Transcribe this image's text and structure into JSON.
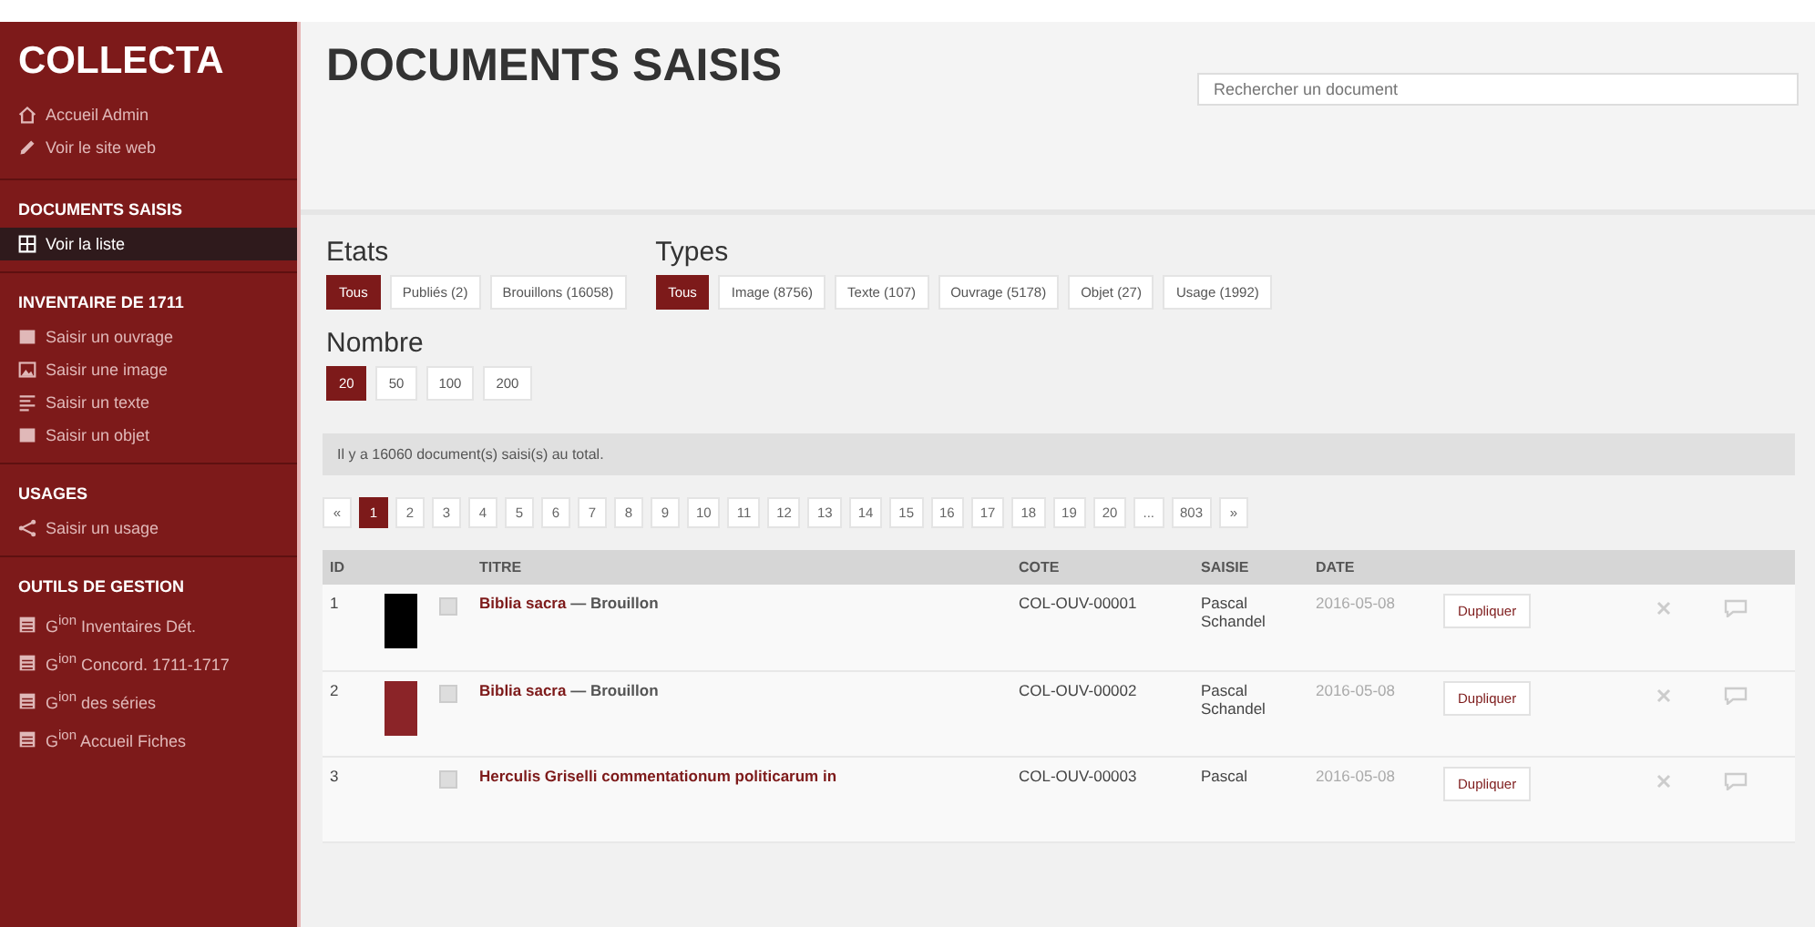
{
  "sidebar": {
    "brand": "COLLECTA",
    "links": [
      {
        "kind": "home",
        "label": "Accueil Admin"
      },
      {
        "kind": "pencil",
        "label": "Voir le site web"
      }
    ],
    "sections": [
      {
        "title": "DOCUMENTS SAISIS",
        "items": [
          {
            "kind": "grid",
            "label": "Voir la liste",
            "selected": true
          }
        ]
      },
      {
        "title": "INVENTAIRE DE 1711",
        "items": [
          {
            "kind": "book",
            "label": "Saisir un ouvrage",
            "selected": false
          },
          {
            "kind": "image",
            "label": "Saisir une image",
            "selected": false
          },
          {
            "kind": "text",
            "label": "Saisir un texte",
            "selected": false
          },
          {
            "kind": "book",
            "label": "Saisir un objet",
            "selected": false
          }
        ]
      },
      {
        "title": "USAGES",
        "items": [
          {
            "kind": "share",
            "label": "Saisir un usage",
            "selected": false
          }
        ]
      },
      {
        "title": "OUTILS DE GESTION",
        "items": [
          {
            "kind": "table",
            "label": "G$^{ion}$ Inventaires Dét.",
            "selected": false
          },
          {
            "kind": "table",
            "label": "G$^{ion}$ Concord. 1711-1717",
            "selected": false
          },
          {
            "kind": "table",
            "label": "G$^{ion}$ des séries",
            "selected": false
          },
          {
            "kind": "table",
            "label": "G$^{ion}$ Accueil Fiches",
            "selected": false
          }
        ]
      }
    ]
  },
  "header": {
    "title": "DOCUMENTS SAISIS",
    "search": {
      "placeholder": "Rechercher un document"
    }
  },
  "filters": [
    {
      "title": "Etats",
      "options": [
        {
          "label": "Tous",
          "selected": true
        },
        {
          "label": "Publiés (2)",
          "selected": false
        },
        {
          "label": "Brouillons (16058)",
          "selected": false
        }
      ]
    },
    {
      "title": "Types",
      "options": [
        {
          "label": "Tous",
          "selected": true
        },
        {
          "label": "Image (8756)",
          "selected": false
        },
        {
          "label": "Texte (107)",
          "selected": false
        },
        {
          "label": "Ouvrage (5178)",
          "selected": false
        },
        {
          "label": "Objet (27)",
          "selected": false
        },
        {
          "label": "Usage (1992)",
          "selected": false
        }
      ]
    },
    {
      "title": "Nombre",
      "options": [
        {
          "label": "20",
          "selected": true
        },
        {
          "label": "50",
          "selected": false
        },
        {
          "label": "100",
          "selected": false
        },
        {
          "label": "200",
          "selected": false
        }
      ]
    }
  ],
  "info": "Il y a 16060 document(s) saisi(s) au total.",
  "pagination": [
    {
      "label": "«",
      "selected": false
    },
    {
      "label": "1",
      "selected": true
    },
    {
      "label": "2",
      "selected": false
    },
    {
      "label": "3",
      "selected": false
    },
    {
      "label": "4",
      "selected": false
    },
    {
      "label": "5",
      "selected": false
    },
    {
      "label": "6",
      "selected": false
    },
    {
      "label": "7",
      "selected": false
    },
    {
      "label": "8",
      "selected": false
    },
    {
      "label": "9",
      "selected": false
    },
    {
      "label": "10",
      "selected": false
    },
    {
      "label": "11",
      "selected": false
    },
    {
      "label": "12",
      "selected": false
    },
    {
      "label": "13",
      "selected": false
    },
    {
      "label": "14",
      "selected": false
    },
    {
      "label": "15",
      "selected": false
    },
    {
      "label": "16",
      "selected": false
    },
    {
      "label": "17",
      "selected": false
    },
    {
      "label": "18",
      "selected": false
    },
    {
      "label": "19",
      "selected": false
    },
    {
      "label": "20",
      "selected": false
    },
    {
      "label": "...",
      "selected": false
    },
    {
      "label": "803",
      "selected": false
    },
    {
      "label": "»",
      "selected": false
    }
  ],
  "table": {
    "columns": [
      "ID",
      "TITRE",
      "COTE",
      "SAISIE",
      "DATE"
    ],
    "rows": [
      {
        "id": "1",
        "color": "#000000",
        "title": "Biblia sacra",
        "status": "— Brouillon",
        "cote": "COL-OUV-00001",
        "saisie": "Pascal Schandel",
        "date": "2016-05-08",
        "action": "Dupliquer"
      },
      {
        "id": "2",
        "color": "#8b2428",
        "title": "Biblia sacra",
        "status": "— Brouillon",
        "cote": "COL-OUV-00002",
        "saisie": "Pascal Schandel",
        "date": "2016-05-08",
        "action": "Dupliquer"
      },
      {
        "id": "3",
        "title": "Herculis Griselli commentationum politicarum in",
        "cote": "COL-OUV-00003",
        "saisie": "Pascal",
        "date": "2016-05-08",
        "action": "Dupliquer"
      }
    ]
  }
}
